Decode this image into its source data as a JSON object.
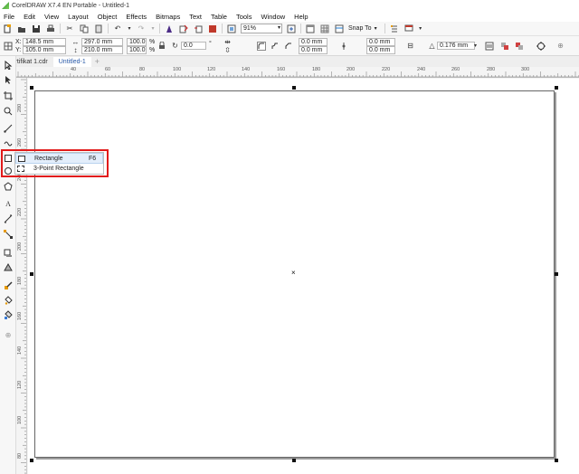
{
  "window": {
    "title": "CorelDRAW X7.4 EN Portable - Untitled-1"
  },
  "menubar": {
    "items": [
      {
        "key": "F",
        "rest": "ile"
      },
      {
        "key": "E",
        "rest": "dit"
      },
      {
        "key": "V",
        "rest": "iew"
      },
      {
        "key": "L",
        "rest": "ayout"
      },
      {
        "key": "O",
        "rest": "bject"
      },
      {
        "key": "E",
        "rest": "ffects",
        "pre": "Eff",
        "mid": "e",
        "post": "cts"
      },
      {
        "key": "B",
        "rest": "itmaps"
      },
      {
        "key": "T",
        "rest": "ext",
        "pre": "Te",
        "mid": "x",
        "post": "t"
      },
      {
        "key": "T",
        "rest": "able",
        "pre": "T",
        "mid": "a",
        "post": "ble"
      },
      {
        "key": "T",
        "rest": "ools",
        "pre": "T",
        "mid": "o",
        "post": "ols"
      },
      {
        "key": "W",
        "rest": "indow"
      },
      {
        "key": "H",
        "rest": "elp"
      }
    ],
    "labels": [
      "File",
      "Edit",
      "View",
      "Layout",
      "Object",
      "Effects",
      "Bitmaps",
      "Text",
      "Table",
      "Tools",
      "Window",
      "Help"
    ]
  },
  "standard_toolbar": {
    "zoom_value": "91%",
    "snap_to_label": "Snap To"
  },
  "property_bar": {
    "x_label": "X:",
    "x_value": "148.5 mm",
    "y_label": "Y:",
    "y_value": "105.0 mm",
    "width_value": "297.0 mm",
    "height_value": "210.0 mm",
    "scale_w": "100.0",
    "scale_h": "100.0",
    "percent": "%",
    "rotation_value": "0.0",
    "degree": "°",
    "corner_1": "0.0 mm",
    "corner_2": "0.0 mm",
    "corner_3": "0.0 mm",
    "corner_4": "0.0 mm",
    "outline_width": "0.176 mm"
  },
  "document_tabs": [
    {
      "label": "Sertifikat 1.cdr",
      "active": false
    },
    {
      "label": "Untitled-1",
      "active": true
    }
  ],
  "rulers": {
    "horizontal": [
      "40",
      "60",
      "80",
      "100",
      "120",
      "140",
      "160",
      "180",
      "200",
      "220",
      "240",
      "260",
      "280",
      "300"
    ],
    "vertical": [
      "280",
      "260",
      "240",
      "220",
      "200",
      "180",
      "160",
      "140",
      "120",
      "100",
      "80",
      "60",
      "40"
    ]
  },
  "flyout": {
    "items": [
      {
        "label": "Rectangle",
        "shortcut": "F6",
        "highlighted": true,
        "icon": "rectangle-icon"
      },
      {
        "label": "3-Point Rectangle",
        "shortcut": "",
        "highlighted": false,
        "icon": "3-point-rectangle-icon"
      }
    ]
  },
  "colors": {
    "highlight_box": "#e21b1b",
    "accent_tab_text": "#2a5aa8",
    "flyout_highlight": "#e3eefb"
  }
}
